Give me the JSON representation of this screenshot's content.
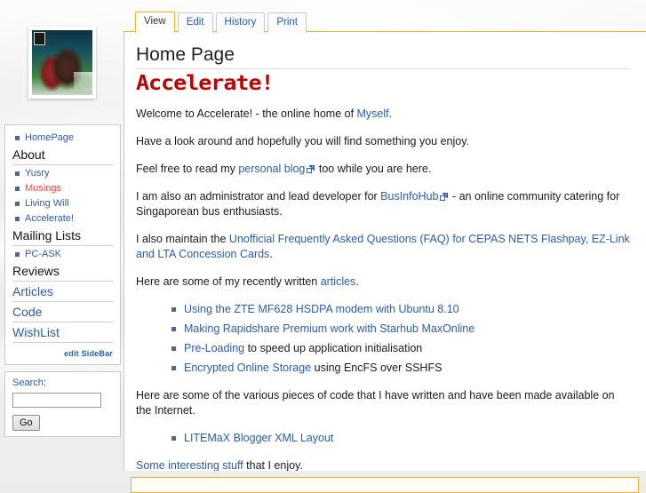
{
  "sidebar": {
    "logo": {
      "alt": "site-photo-thumbnail"
    },
    "nav": {
      "home_item": "HomePage",
      "about_heading": "About",
      "about_items": [
        {
          "label": "Yusry",
          "style": "blue"
        },
        {
          "label": "Musings",
          "style": "red"
        },
        {
          "label": "Living Will",
          "style": "blue"
        },
        {
          "label": "Accelerate!",
          "style": "blue"
        }
      ],
      "mailing_heading": "Mailing Lists",
      "mailing_items": [
        {
          "label": "PC-ASK",
          "style": "blue"
        }
      ],
      "reviews_heading": "Reviews",
      "articles_heading": "Articles",
      "code_heading": "Code",
      "wishlist_heading": "WishList",
      "edit_sidebar": "edit SideBar"
    },
    "search": {
      "label_link": "Search",
      "label_colon": ":",
      "value": "",
      "placeholder": "",
      "go_label": "Go"
    }
  },
  "tabs": [
    {
      "label": "View",
      "active": true
    },
    {
      "label": "Edit",
      "active": false
    },
    {
      "label": "History",
      "active": false
    },
    {
      "label": "Print",
      "active": false
    }
  ],
  "page": {
    "title": "Home Page",
    "logo_text": "Accelerate!",
    "p1_a": "Welcome to Accelerate! - the online home of ",
    "p1_link": "Myself",
    "p1_b": ".",
    "p2": "Have a look around and hopefully you will find something you enjoy.",
    "p3_a": "Feel free to read my ",
    "p3_link": "personal blog",
    "p3_b": " too while you are here.",
    "p4_a": "I am also an administrator and lead developer for ",
    "p4_link": "BusInfoHub",
    "p4_b": " - an online community catering for Singaporean bus enthusiasts.",
    "p5_a": "I also maintain the ",
    "p5_link": "Unofficial Frequently Asked Questions (FAQ) for CEPAS NETS Flashpay, EZ-Link and LTA Concession Cards",
    "p5_b": ".",
    "p6_a": "Here are some of my recently written ",
    "p6_link": "articles",
    "p6_b": ".",
    "articles_list": [
      {
        "link": "Using the ZTE MF628 HSDPA modem with Ubuntu 8.10",
        "rest": ""
      },
      {
        "link": "Making Rapidshare Premium work with Starhub MaxOnline",
        "rest": ""
      },
      {
        "link": "Pre-Loading",
        "rest": " to speed up application initialisation"
      },
      {
        "link": "Encrypted Online Storage",
        "rest": " using EncFS over SSHFS"
      }
    ],
    "p7": "Here are some of the various pieces of code that I have written and have been made available on the Internet.",
    "code_list": [
      {
        "link": "LITEMaX Blogger XML Layout",
        "rest": ""
      }
    ],
    "p8_link": "Some interesting stuff",
    "p8_rest": " that I enjoy."
  },
  "colors": {
    "link": "#2a5bb5",
    "redlink": "#ff4136",
    "accent": "#f0b323",
    "logo_red": "#c00000"
  }
}
